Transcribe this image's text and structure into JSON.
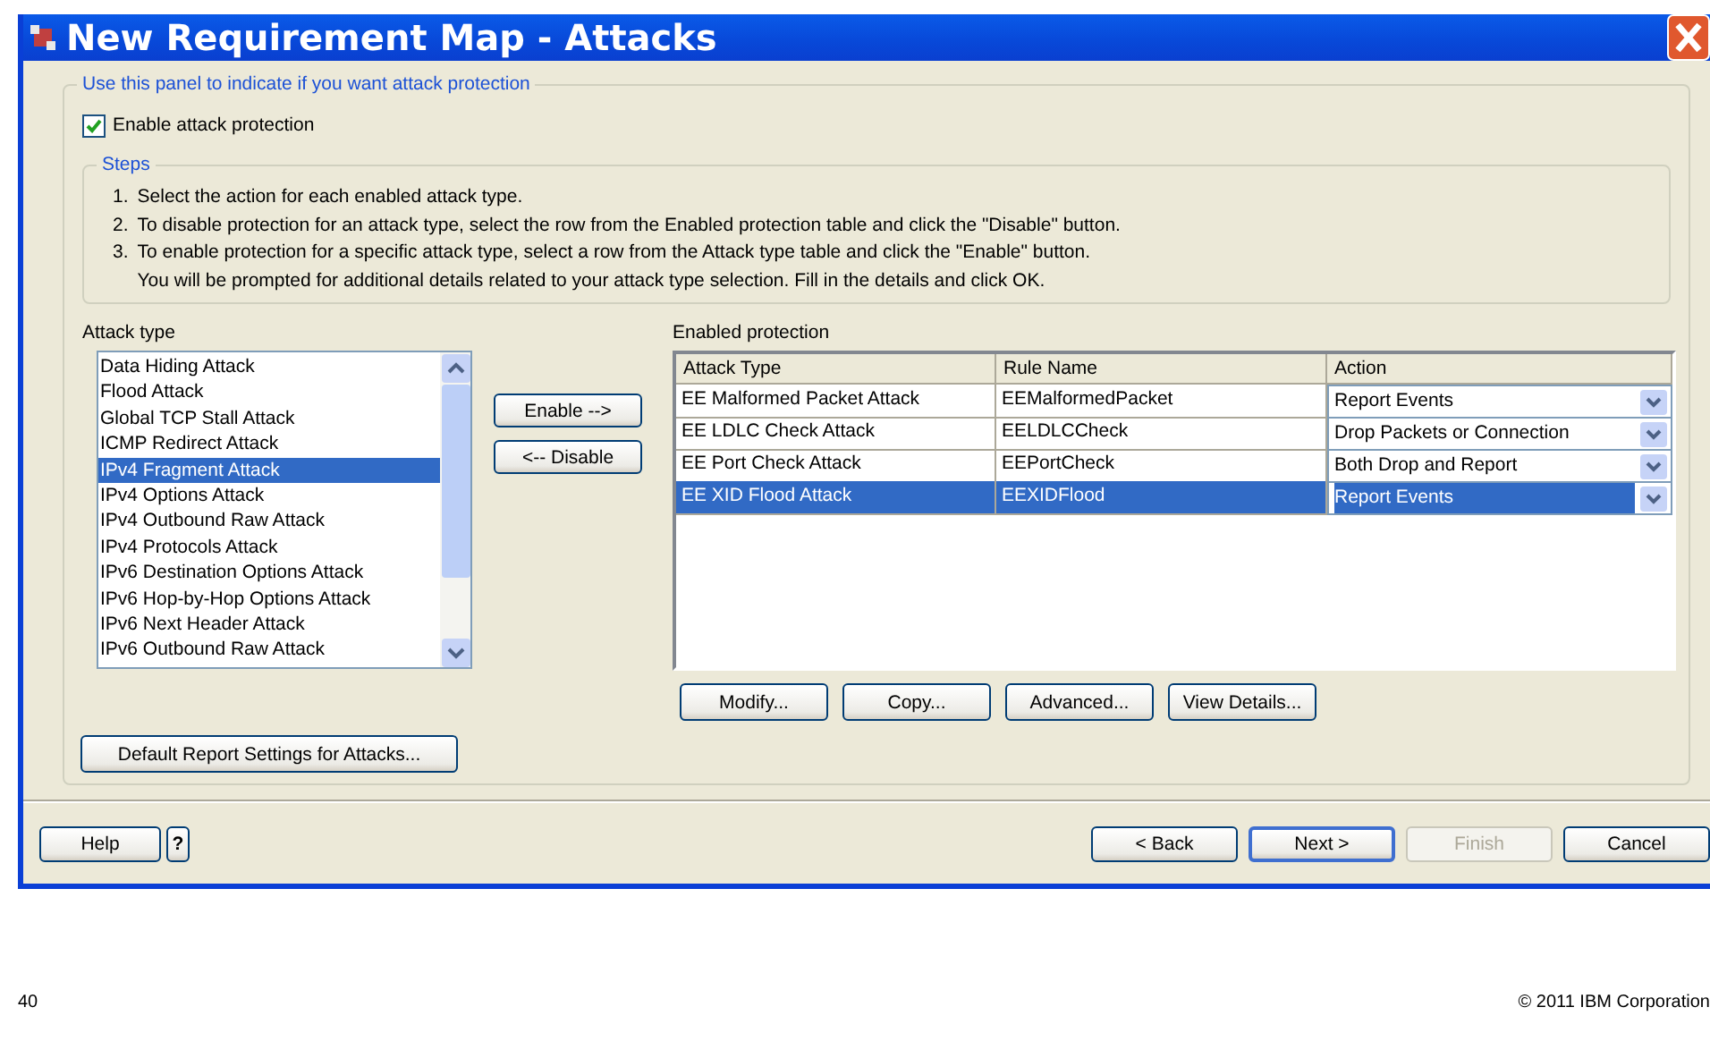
{
  "window": {
    "title": "New Requirement Map - Attacks"
  },
  "panel": {
    "legend": "Use this panel to indicate if you want attack protection"
  },
  "enable_checkbox": {
    "label": "Enable attack protection",
    "checked": true
  },
  "steps": {
    "legend": "Steps",
    "items": [
      {
        "number": "1.",
        "lines": [
          "Select the action for each enabled attack type."
        ]
      },
      {
        "number": "2.",
        "lines": [
          "To disable protection for an attack type, select the row from the Enabled protection  table and click the \"Disable\" button."
        ]
      },
      {
        "number": "3.",
        "lines": [
          "To enable protection for a specific attack type, select a row from the Attack type table and click the \"Enable\" button.",
          "You will be prompted for additional details related to your attack type selection.  Fill in the details and click OK."
        ]
      }
    ]
  },
  "attack_type": {
    "label": "Attack type",
    "items": [
      {
        "label": "Data Hiding Attack",
        "selected": false
      },
      {
        "label": "Flood Attack",
        "selected": false
      },
      {
        "label": "Global TCP Stall Attack",
        "selected": false
      },
      {
        "label": "ICMP Redirect Attack",
        "selected": false
      },
      {
        "label": "IPv4 Fragment Attack",
        "selected": true
      },
      {
        "label": "IPv4 Options Attack",
        "selected": false
      },
      {
        "label": "IPv4 Outbound Raw Attack",
        "selected": false
      },
      {
        "label": "IPv4 Protocols Attack",
        "selected": false
      },
      {
        "label": "IPv6 Destination Options Attack",
        "selected": false
      },
      {
        "label": "IPv6 Hop-by-Hop Options Attack",
        "selected": false
      },
      {
        "label": "IPv6 Next Header Attack",
        "selected": false
      },
      {
        "label": "IPv6 Outbound Raw Attack",
        "selected": false
      }
    ]
  },
  "move_buttons": [
    "Enable -->",
    "<-- Disable"
  ],
  "enabled_protection": {
    "label": "Enabled protection",
    "columns": [
      "Attack Type",
      "Rule Name",
      "Action"
    ],
    "rows": [
      {
        "attack_type": "EE Malformed Packet Attack",
        "rule_name": "EEMalformedPacket",
        "action": "Report Events",
        "selected": false
      },
      {
        "attack_type": "EE LDLC Check Attack",
        "rule_name": "EELDLCCheck",
        "action": "Drop Packets or Connection",
        "selected": false
      },
      {
        "attack_type": "EE Port Check Attack",
        "rule_name": "EEPortCheck",
        "action": "Both Drop and Report",
        "selected": false
      },
      {
        "attack_type": "EE XID Flood Attack",
        "rule_name": "EEXIDFlood",
        "action": "Report Events",
        "selected": true
      }
    ]
  },
  "table_buttons": [
    "Modify...",
    "Copy...",
    "Advanced...",
    "View Details..."
  ],
  "default_report_button": "Default Report Settings for Attacks...",
  "footer_buttons": {
    "help": "Help",
    "help_icon": "?",
    "nav": [
      {
        "label": "< Back",
        "disabled": false,
        "default": false
      },
      {
        "label": "Next >",
        "disabled": false,
        "default": true
      },
      {
        "label": "Finish",
        "disabled": true,
        "default": false
      },
      {
        "label": "Cancel",
        "disabled": false,
        "default": false
      }
    ]
  },
  "slide_footer": {
    "page_number": "40",
    "copyright": "© 2011 IBM Corporation"
  }
}
